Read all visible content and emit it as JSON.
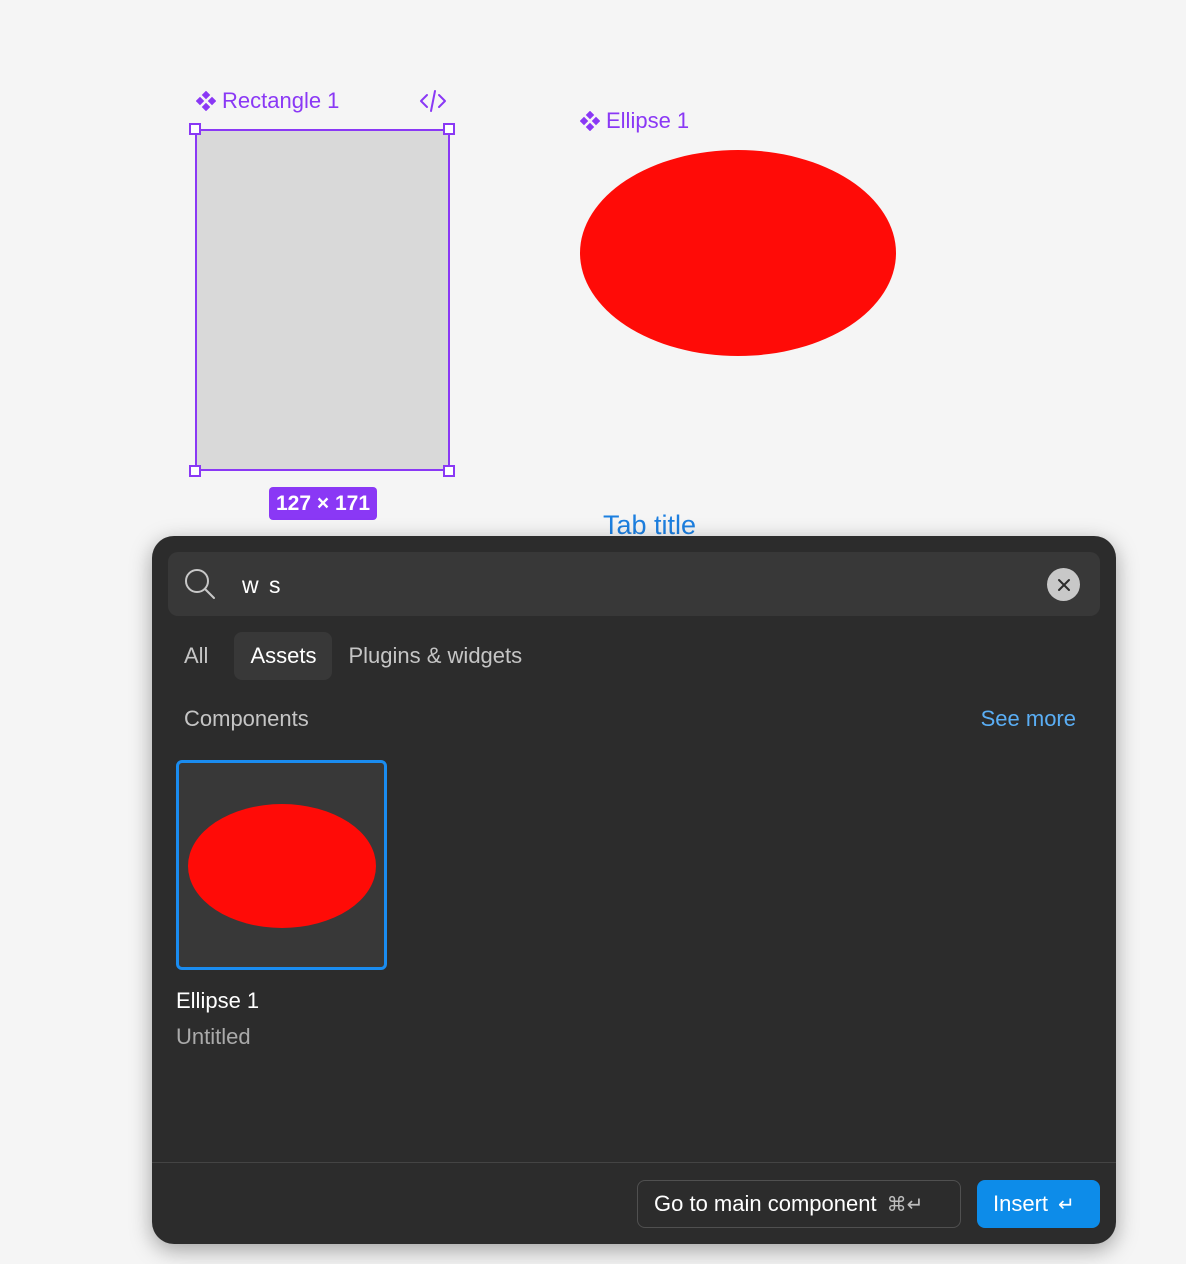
{
  "canvas": {
    "rectangle_label": "Rectangle 1",
    "rectangle_dimensions": "127 × 171",
    "ellipse_label": "Ellipse 1",
    "tab_title": "Tab title",
    "selection_color": "#8a38f5",
    "rectangle_fill": "#d9d9d9",
    "ellipse_fill": "#ff0b07",
    "code_icon": "code-icon"
  },
  "quick_actions": {
    "search": {
      "value": "w s",
      "icon": "search-icon",
      "clear_icon": "close-icon"
    },
    "tabs": [
      {
        "label": "All",
        "active": false
      },
      {
        "label": "Assets",
        "active": true
      },
      {
        "label": "Plugins & widgets",
        "active": false
      }
    ],
    "section": {
      "title": "Components",
      "see_more": "See more"
    },
    "results": [
      {
        "name": "Ellipse 1",
        "file": "Untitled",
        "selected": true
      }
    ],
    "footer": {
      "go_to_main_label": "Go to main component",
      "go_to_main_shortcut": "⌘↵",
      "insert_label": "Insert",
      "insert_shortcut": "↵",
      "accent_color": "#0d8ce9"
    }
  }
}
